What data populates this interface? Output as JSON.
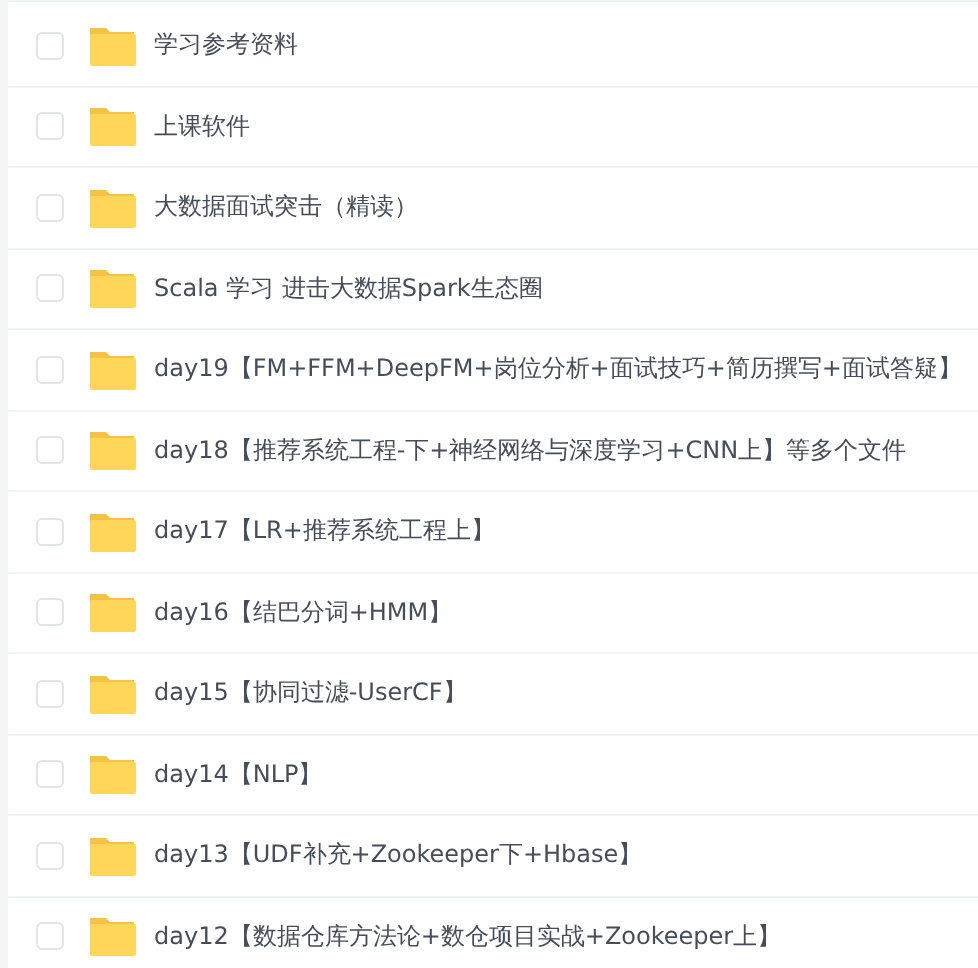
{
  "files": [
    {
      "name": "学习参考资料",
      "checked": false
    },
    {
      "name": "上课软件",
      "checked": false
    },
    {
      "name": "大数据面试突击（精读）",
      "checked": false
    },
    {
      "name": "Scala 学习 进击大数据Spark生态圈",
      "checked": false
    },
    {
      "name": "day19【FM+FFM+DeepFM+岗位分析+面试技巧+简历撰写+面试答疑】",
      "checked": false
    },
    {
      "name": "day18【推荐系统工程-下+神经网络与深度学习+CNN上】等多个文件",
      "checked": false
    },
    {
      "name": "day17【LR+推荐系统工程上】",
      "checked": false
    },
    {
      "name": "day16【结巴分词+HMM】",
      "checked": false
    },
    {
      "name": "day15【协同过滤-UserCF】",
      "checked": false
    },
    {
      "name": "day14【NLP】",
      "checked": false
    },
    {
      "name": "day13【UDF补充+Zookeeper下+Hbase】",
      "checked": false
    },
    {
      "name": "day12【数据仓库方法论+数仓项目实战+Zookeeper上】",
      "checked": false
    }
  ]
}
